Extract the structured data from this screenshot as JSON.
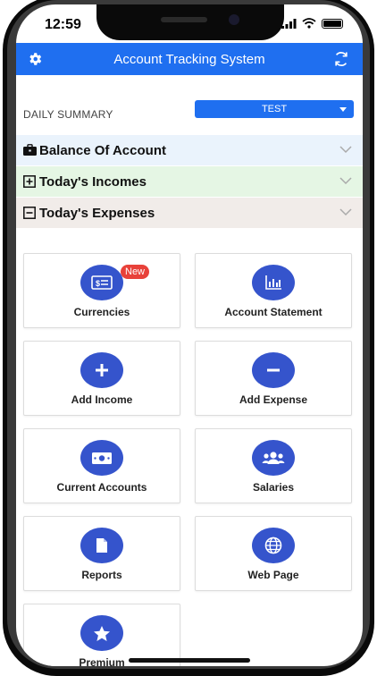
{
  "status_bar": {
    "time": "12:59"
  },
  "app_bar": {
    "title": "Account Tracking System",
    "settings_icon": "gear-icon",
    "sync_icon": "sync-icon"
  },
  "summary": {
    "label": "DAILY SUMMARY",
    "dropdown_value": "TEST"
  },
  "sections": [
    {
      "label": "Balance Of Account",
      "icon": "briefcase-icon",
      "color": "#eaf3fc"
    },
    {
      "label": "Today's Incomes",
      "icon": "plus-square-icon",
      "color": "#e5f6e4"
    },
    {
      "label": "Today's Expenses",
      "icon": "minus-square-icon",
      "color": "#f1ece9"
    }
  ],
  "menu": [
    {
      "label": "Currencies",
      "icon": "currency-icon",
      "badge": "New"
    },
    {
      "label": "Account Statement",
      "icon": "chart-icon"
    },
    {
      "label": "Add Income",
      "icon": "plus-icon"
    },
    {
      "label": "Add Expense",
      "icon": "minus-icon"
    },
    {
      "label": "Current Accounts",
      "icon": "cash-icon"
    },
    {
      "label": "Salaries",
      "icon": "users-icon"
    },
    {
      "label": "Reports",
      "icon": "file-icon"
    },
    {
      "label": "Web Page",
      "icon": "globe-icon"
    },
    {
      "label": "Premium",
      "icon": "star-icon"
    }
  ],
  "colors": {
    "accent": "#1f6ff0",
    "icon_circle": "#3554cc",
    "badge": "#e8413a"
  }
}
